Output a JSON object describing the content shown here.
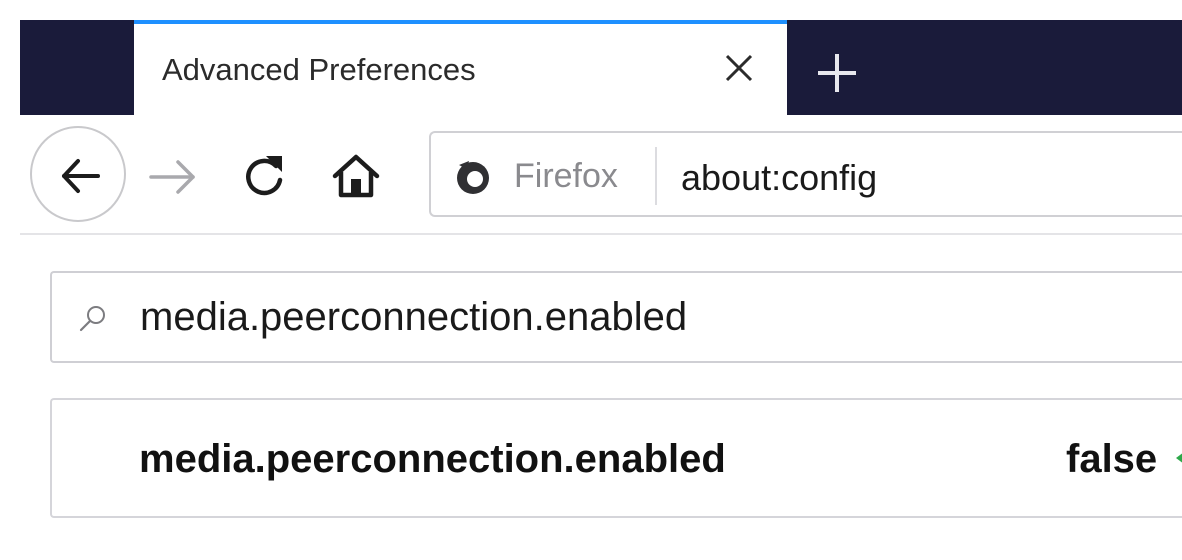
{
  "tab": {
    "title": "Advanced Preferences",
    "close_icon": "close-icon",
    "new_tab_icon": "plus-icon",
    "accent_color": "#1e90ff"
  },
  "theme": {
    "tabstrip_bg": "#1a1b3a"
  },
  "toolbar": {
    "back_icon": "arrow-left-icon",
    "forward_icon": "arrow-right-icon",
    "reload_icon": "reload-icon",
    "home_icon": "home-icon"
  },
  "urlbar": {
    "identity_label": "Firefox",
    "identity_icon": "firefox-icon",
    "url": "about:config"
  },
  "search": {
    "icon": "search-icon",
    "value": "media.peerconnection.enabled"
  },
  "preferences": [
    {
      "name": "media.peerconnection.enabled",
      "value": "false",
      "toggle_icon": "toggle-icon",
      "toggle_color": "#2ea84a"
    }
  ]
}
